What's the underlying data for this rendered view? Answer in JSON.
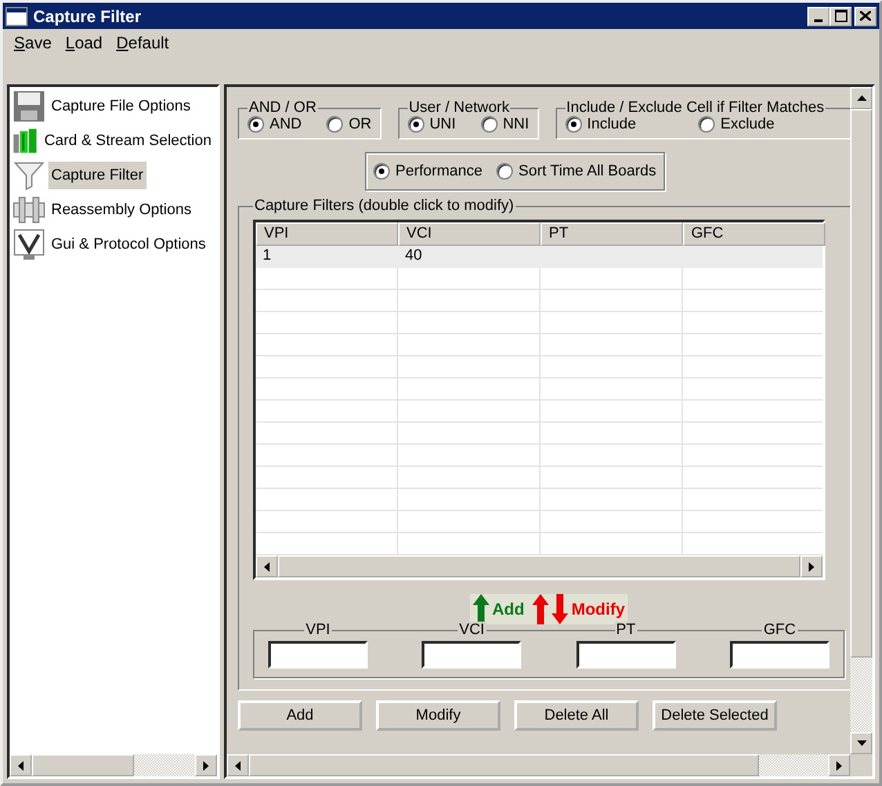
{
  "window": {
    "title": "Capture Filter"
  },
  "menu": [
    {
      "label": "Save"
    },
    {
      "label": "Load"
    },
    {
      "label": "Default"
    }
  ],
  "sidebar": {
    "items": [
      {
        "label": "Capture File Options",
        "selected": false
      },
      {
        "label": "Card & Stream Selection",
        "selected": false
      },
      {
        "label": "Capture Filter",
        "selected": true
      },
      {
        "label": "Reassembly Options",
        "selected": false
      },
      {
        "label": "Gui & Protocol Options",
        "selected": false
      }
    ]
  },
  "option_groups": [
    {
      "title": "AND / OR",
      "options": [
        {
          "label": "AND",
          "selected": true
        },
        {
          "label": "OR",
          "selected": false
        }
      ]
    },
    {
      "title": "User / Network",
      "options": [
        {
          "label": "UNI",
          "selected": true
        },
        {
          "label": "NNI",
          "selected": false
        }
      ]
    },
    {
      "title": "Include / Exclude Cell if Filter Matches",
      "options": [
        {
          "label": "Include",
          "selected": true
        },
        {
          "label": "Exclude",
          "selected": false
        }
      ]
    }
  ],
  "mode": {
    "options": [
      {
        "label": "Performance",
        "selected": true
      },
      {
        "label": "Sort Time All Boards",
        "selected": false
      }
    ]
  },
  "filters": {
    "title": "Capture Filters (double click to modify)",
    "columns": [
      "VPI",
      "VCI",
      "PT",
      "GFC"
    ],
    "rows": [
      {
        "cells": [
          "1",
          "40"
        ],
        "selected": true
      }
    ],
    "legend": {
      "add": "Add",
      "modify": "Modify"
    },
    "fields": [
      {
        "label": "VPI"
      },
      {
        "label": "VCI"
      },
      {
        "label": "PT"
      },
      {
        "label": "GFC"
      }
    ]
  },
  "buttons": [
    "Add",
    "Modify",
    "Delete All",
    "Delete Selected"
  ]
}
